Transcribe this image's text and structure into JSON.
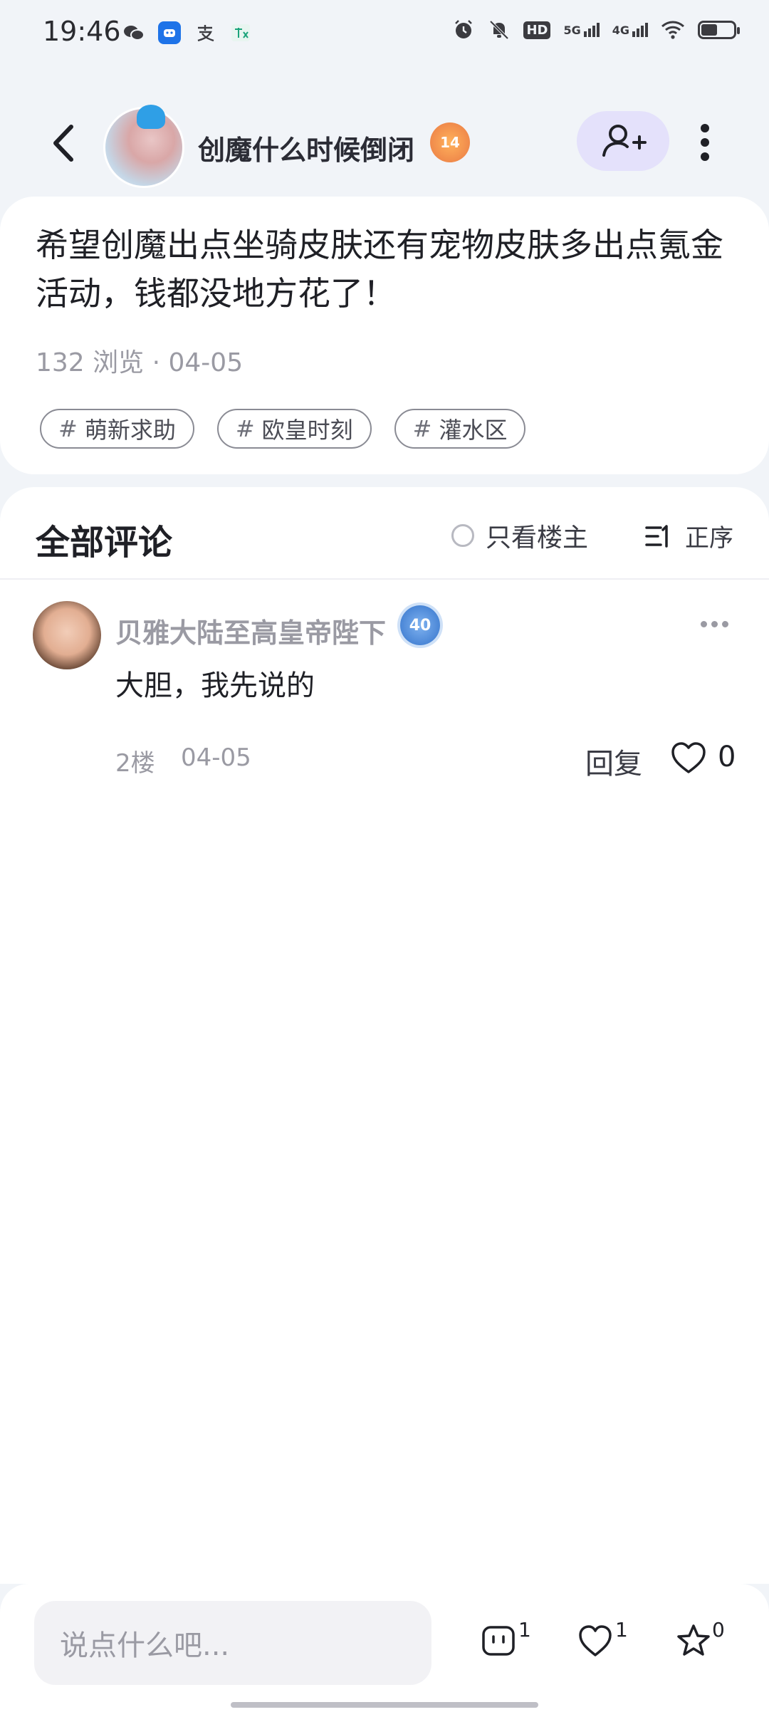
{
  "status_bar": {
    "time": "19:46",
    "left_icons": [
      "wechat-icon",
      "app-icon",
      "alipay-icon",
      "translate-icon"
    ],
    "right_icons": [
      "alarm-icon",
      "silent-icon",
      "hd-icon",
      "5g-signal-icon",
      "4g-signal-icon",
      "wifi-icon",
      "battery-icon"
    ],
    "network_5g": "5G",
    "network_4g": "4G",
    "hd_label": "HD"
  },
  "header": {
    "author_name": "创魔什么时候倒闭",
    "level_badge": "14",
    "follow_icon": "add-user-icon",
    "more_icon": "vertical-dots-icon"
  },
  "post": {
    "content": "希望创魔出点坐骑皮肤还有宠物皮肤多出点氪金活动，钱都没地方花了！",
    "meta": "132 浏览 · 04-05",
    "tags": [
      {
        "label": "萌新求助"
      },
      {
        "label": "欧皇时刻"
      },
      {
        "label": "灌水区"
      }
    ]
  },
  "comments_section": {
    "title": "全部评论",
    "only_author_label": "只看楼主",
    "sort_label": "正序"
  },
  "comments": [
    {
      "username": "贝雅大陆至高皇帝陛下",
      "level": "40",
      "text": "大胆，我先说的",
      "floor": "2楼",
      "date": "04-05",
      "reply_label": "回复",
      "likes": "0"
    }
  ],
  "bottom_bar": {
    "input_placeholder": "说点什么吧...",
    "comment_count": "1",
    "like_count": "1",
    "favorite_count": "0"
  },
  "colors": {
    "accent_follow_bg": "#e4e1fb",
    "page_bg": "#f1f4f8"
  }
}
